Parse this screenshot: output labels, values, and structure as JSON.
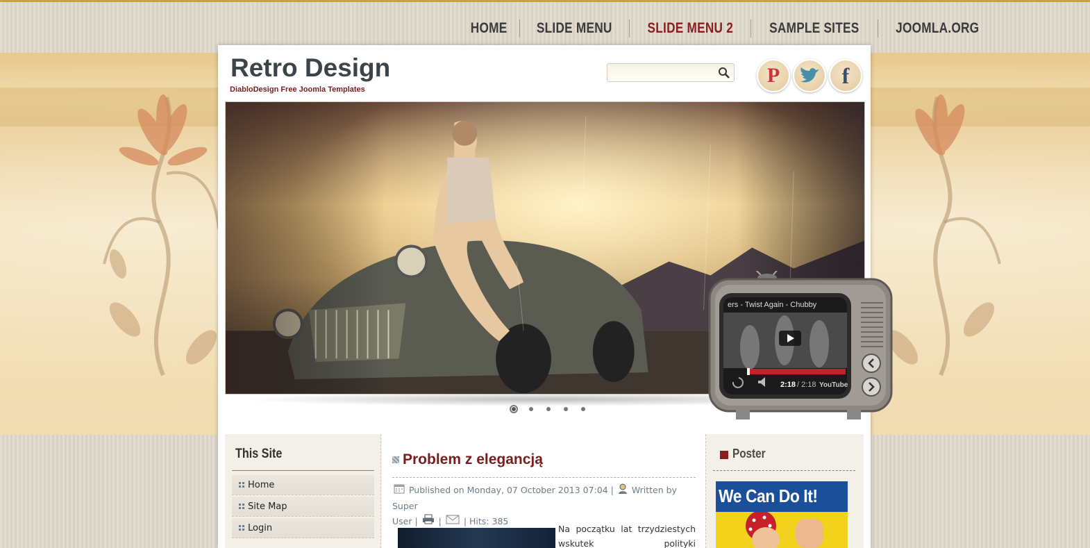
{
  "nav": {
    "items": [
      {
        "label": "HOME"
      },
      {
        "label": "SLIDE MENU"
      },
      {
        "label": "SLIDE MENU 2"
      },
      {
        "label": "SAMPLE SITES"
      },
      {
        "label": "JOOMLA.ORG"
      }
    ],
    "active": "SLIDE MENU 2"
  },
  "header": {
    "title": "Retro Design",
    "subtitle": "DiabloDesign Free Joomla Templates"
  },
  "search": {
    "placeholder": "",
    "value": ""
  },
  "social": {
    "icons": [
      "pinterest-icon",
      "twitter-icon",
      "facebook-icon"
    ]
  },
  "slider": {
    "dots_count": 5,
    "active_dot": 1
  },
  "tv_video": {
    "title": "ers - Twist Again - Chubby",
    "time_current": "2:18",
    "time_total": "/ 2:18",
    "brand": "YouTube"
  },
  "left_module": {
    "title": "This Site",
    "items": [
      {
        "label": "Home"
      },
      {
        "label": "Site Map"
      },
      {
        "label": "Login"
      }
    ]
  },
  "article": {
    "title": "Problem z elegancją",
    "meta_line1": "Published on Monday, 07 October 2013 07:04 |",
    "written_by": "Written by Super",
    "meta_line2_user": "User |",
    "sep": "|",
    "hits": "| Hits: 385",
    "text_line1": "Na początku lat trzydziestych",
    "text_line2": "wskutek polityki"
  },
  "right_module": {
    "title": "Poster",
    "poster_text": "We Can Do It!"
  },
  "colors": {
    "accent": "#8a1e1e",
    "nav_text": "#3a3a3a",
    "title_text": "#3b4549",
    "meta_text": "#6d7d89"
  }
}
